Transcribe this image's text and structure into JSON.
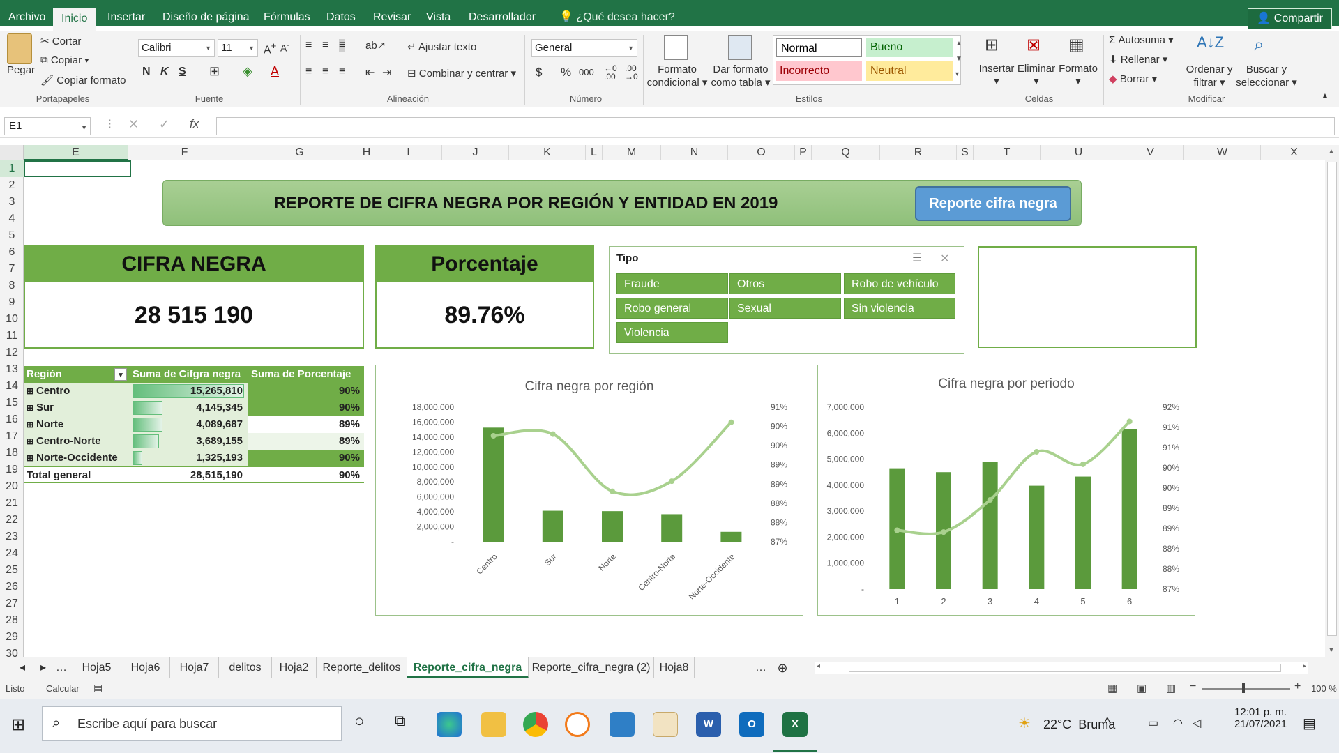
{
  "ribbon_tabs": [
    "Archivo",
    "Inicio",
    "Insertar",
    "Diseño de página",
    "Fórmulas",
    "Datos",
    "Revisar",
    "Vista",
    "Desarrollador"
  ],
  "tell_me": "¿Qué desea hacer?",
  "share": "Compartir",
  "clipboard": {
    "paste": "Pegar",
    "cut": "Cortar",
    "copy": "Copiar",
    "format_painter": "Copiar formato",
    "group": "Portapapeles"
  },
  "font": {
    "name": "Calibri",
    "size": "11",
    "bold": "N",
    "italic": "K",
    "underline": "S",
    "group": "Fuente"
  },
  "alignment": {
    "wrap": "Ajustar texto",
    "merge": "Combinar y centrar",
    "group": "Alineación"
  },
  "number": {
    "format": "General",
    "currency": "$",
    "percent": "%",
    "thousands": "000",
    "group": "Número"
  },
  "styles": {
    "conditional": [
      "Formato",
      "condicional"
    ],
    "table": [
      "Dar formato",
      "como tabla"
    ],
    "cells": [
      {
        "label": "Normal",
        "bg": "#ffffff",
        "fg": "#000000"
      },
      {
        "label": "Bueno",
        "bg": "#c6efce",
        "fg": "#006100"
      },
      {
        "label": "Incorrecto",
        "bg": "#ffc7ce",
        "fg": "#9c0006"
      },
      {
        "label": "Neutral",
        "bg": "#ffeb9c",
        "fg": "#9c5700"
      }
    ],
    "group": "Estilos"
  },
  "cells": {
    "insert": "Insertar",
    "delete": "Eliminar",
    "format": "Formato",
    "group": "Celdas"
  },
  "editing": {
    "autosum": "Autosuma",
    "fill": "Rellenar",
    "clear": "Borrar",
    "sort": [
      "Ordenar y",
      "filtrar"
    ],
    "find": [
      "Buscar y",
      "seleccionar"
    ],
    "group": "Modificar"
  },
  "name_box": "E1",
  "columns": [
    "E",
    "F",
    "G",
    "H",
    "I",
    "J",
    "K",
    "L",
    "M",
    "N",
    "O",
    "P",
    "Q",
    "R",
    "S",
    "T",
    "U",
    "V",
    "W",
    "X"
  ],
  "rows": [
    "1",
    "2",
    "3",
    "4",
    "5",
    "6",
    "7",
    "8",
    "9",
    "10",
    "11",
    "12",
    "13",
    "14",
    "15",
    "16",
    "17",
    "18",
    "19",
    "20",
    "21",
    "22",
    "23",
    "24",
    "25",
    "26",
    "27",
    "28",
    "29",
    "30"
  ],
  "banner": {
    "title": "REPORTE DE CIFRA NEGRA POR REGIÓN Y ENTIDAD EN 2019",
    "button": "Reporte cifra negra"
  },
  "kpi": [
    {
      "title": "CIFRA NEGRA",
      "value": "28 515 190"
    },
    {
      "title": "Porcentaje",
      "value": "89.76%"
    }
  ],
  "slicer": {
    "title": "Tipo",
    "items": [
      "Fraude",
      "Otros",
      "Robo de vehículo",
      "Robo general",
      "Sexual",
      "Sin violencia",
      "Violencia"
    ]
  },
  "pivot": {
    "headers": [
      "Región",
      "Suma de Cifgra negra",
      "Suma de Porcentaje"
    ],
    "rows": [
      {
        "region": "Centro",
        "sum": "15,265,810",
        "pct": "90%",
        "bar": 1.0,
        "pct_fill": "#70ad47"
      },
      {
        "region": "Sur",
        "sum": "4,145,345",
        "pct": "90%",
        "bar": 0.27,
        "pct_fill": "#70ad47"
      },
      {
        "region": "Norte",
        "sum": "4,089,687",
        "pct": "89%",
        "bar": 0.27,
        "pct_fill": "#ffffff"
      },
      {
        "region": "Centro-Norte",
        "sum": "3,689,155",
        "pct": "89%",
        "bar": 0.24,
        "pct_fill": "#edf5e9"
      },
      {
        "region": "Norte-Occidente",
        "sum": "1,325,193",
        "pct": "90%",
        "bar": 0.09,
        "pct_fill": "#70ad47"
      }
    ],
    "total": {
      "label": "Total general",
      "sum": "28,515,190",
      "pct": "90%"
    }
  },
  "chart_data": [
    {
      "type": "bar",
      "title": "Cifra negra por región",
      "categories": [
        "Centro",
        "Sur",
        "Norte",
        "Centro-Norte",
        "Norte-Occidente"
      ],
      "series": [
        {
          "values": [
            15265810,
            4145345,
            4089687,
            3689155,
            1325193
          ],
          "axis": "left",
          "color": "#5b9a3c"
        },
        {
          "type": "line",
          "values": [
            90.15,
            90.2,
            88.5,
            88.8,
            90.55
          ],
          "axis": "right",
          "color": "#a9d18e"
        }
      ],
      "ylim": [
        0,
        18000000
      ],
      "yticks": [
        "-",
        "2,000,000",
        "4,000,000",
        "6,000,000",
        "8,000,000",
        "10,000,000",
        "12,000,000",
        "14,000,000",
        "16,000,000",
        "18,000,000"
      ],
      "y2lim": [
        87,
        91
      ],
      "y2ticks": [
        "87%",
        "88%",
        "88%",
        "89%",
        "89%",
        "90%",
        "90%",
        "91%"
      ]
    },
    {
      "type": "bar",
      "title": "Cifra negra por periodo",
      "categories": [
        "1",
        "2",
        "3",
        "4",
        "5",
        "6"
      ],
      "series": [
        {
          "values": [
            4650000,
            4500000,
            4900000,
            3980000,
            4330000,
            6150000
          ],
          "axis": "left",
          "color": "#5b9a3c"
        },
        {
          "type": "line",
          "values": [
            88.35,
            88.3,
            89.2,
            90.55,
            90.2,
            91.4
          ],
          "axis": "right",
          "color": "#a9d18e"
        }
      ],
      "ylim": [
        0,
        7000000
      ],
      "yticks": [
        "-",
        "1,000,000",
        "2,000,000",
        "3,000,000",
        "4,000,000",
        "5,000,000",
        "6,000,000",
        "7,000,000"
      ],
      "y2lim": [
        86.7,
        91.8
      ],
      "y2ticks": [
        "87%",
        "88%",
        "88%",
        "89%",
        "89%",
        "90%",
        "90%",
        "91%",
        "91%",
        "92%"
      ]
    }
  ],
  "sheet_tabs": [
    "Hoja5",
    "Hoja6",
    "Hoja7",
    "delitos",
    "Hoja2",
    "Reporte_delitos",
    "Reporte_cifra_negra",
    "Reporte_cifra_negra (2)",
    "Hoja8"
  ],
  "active_tab": "Reporte_cifra_negra",
  "status": {
    "ready": "Listo",
    "calc": "Calcular",
    "zoom": "100 %"
  },
  "taskbar": {
    "search": "Escribe aquí para buscar",
    "weather": "22°C  Bruma",
    "time": "12:01 p. m.",
    "date": "21/07/2021"
  }
}
